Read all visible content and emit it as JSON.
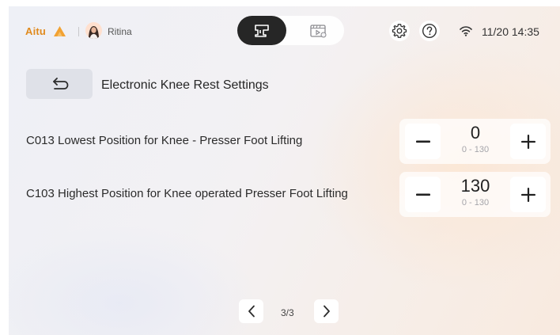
{
  "header": {
    "brand": "Aitu",
    "brand_color": "#e08a1d",
    "user_name": "Ritina",
    "clock": "11/20 14:35"
  },
  "mode_switch": {
    "active_icon": "sewing-machine-icon",
    "inactive_icon": "video-tutorial-icon"
  },
  "page": {
    "title": "Electronic Knee Rest Settings"
  },
  "settings": [
    {
      "label": "C013 Lowest Position for Knee - Presser Foot Lifting",
      "value": "0",
      "range": "0 - 130"
    },
    {
      "label": "C103 Highest Position for Knee operated Presser Foot Lifting",
      "value": "130",
      "range": "0 - 130"
    }
  ],
  "pagination": {
    "indicator": "3/3"
  }
}
